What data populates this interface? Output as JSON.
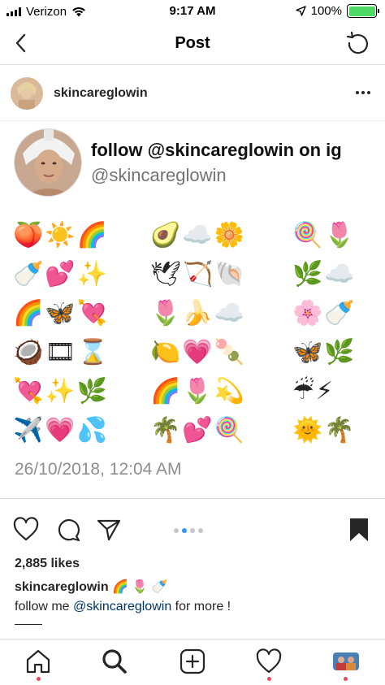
{
  "status_bar": {
    "carrier": "Verizon",
    "time": "9:17 AM",
    "battery": "100%"
  },
  "nav": {
    "title": "Post"
  },
  "post": {
    "username": "skincareglowin"
  },
  "promo": {
    "title": "follow @skincareglowin on ig",
    "handle": "@skincareglowin"
  },
  "emoji_rows": [
    [
      "🍑☀️🌈",
      "🥑☁️🌼",
      "🍭🌷"
    ],
    [
      "🍼💕✨",
      "🕊🏹🐚",
      "🌿☁️"
    ],
    [
      "🌈🦋💘",
      "🌷🍌☁️",
      "🌸🍼"
    ],
    [
      "🥥🎞⌛",
      "🍋💗🍡",
      "🦋🌿"
    ],
    [
      "💘✨🌿",
      "🌈🌷💫",
      "☔⚡"
    ],
    [
      "✈️💗💦",
      "🌴💕🍭",
      "🌞🌴"
    ]
  ],
  "timestamp": "26/10/2018, 12:04 AM",
  "carousel": {
    "total": 4,
    "active": 1
  },
  "likes": "2,885 likes",
  "caption": {
    "username": "skincareglowin",
    "emojis": " 🌈 🌷 🍼",
    "prefix": "follow me ",
    "mention": "@skincareglowin",
    "suffix": " for more !"
  },
  "colors": {
    "accent": "#3897f0",
    "notification": "#ed4956",
    "battery": "#4cd964",
    "mention": "#003569"
  }
}
